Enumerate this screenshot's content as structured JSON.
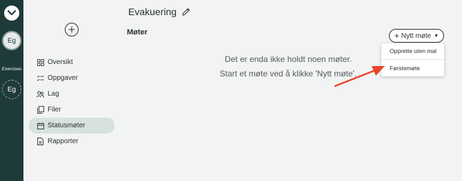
{
  "rail": {
    "avatar_active": "Eg",
    "caption": "Exercises",
    "avatar_other": "Eg"
  },
  "header": {
    "title": "Evakuering",
    "edit_icon": "pencil-icon"
  },
  "sidebar": {
    "add_icon": "plus-circle-icon",
    "items": [
      {
        "label": "Oversikt",
        "icon": "grid-icon"
      },
      {
        "label": "Oppgaver",
        "icon": "checklist-icon"
      },
      {
        "label": "Lag",
        "icon": "team-icon"
      },
      {
        "label": "Filer",
        "icon": "files-icon"
      },
      {
        "label": "Statusmøter",
        "icon": "calendar-icon",
        "active": true
      },
      {
        "label": "Rapporter",
        "icon": "document-icon"
      }
    ]
  },
  "main": {
    "section_title": "Møter",
    "new_button_label": "Nytt møte",
    "dropdown": [
      "Opprette uten mal",
      "Førstemøte"
    ],
    "empty_line1": "Det er enda ikke holdt noen møter.",
    "empty_line2": "Start et møte ved å klikke 'Nytt møte'."
  },
  "colors": {
    "rail_bg": "#1f3b39",
    "page_bg": "#f2f4f3",
    "active_nav": "#d7e1df",
    "annotation_arrow": "#e8452c"
  }
}
